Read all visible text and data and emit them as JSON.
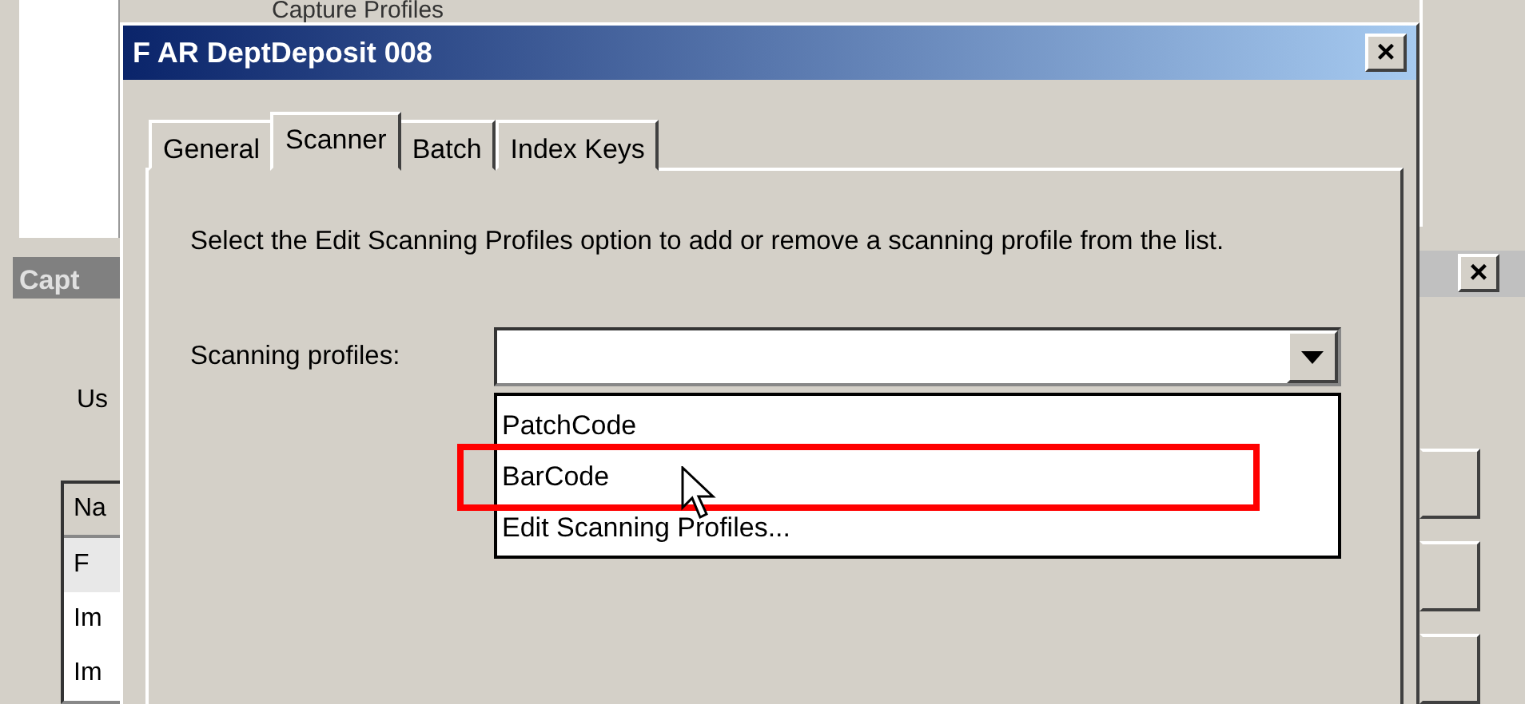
{
  "background_window": {
    "title": "Capture Profiles"
  },
  "capture_window": {
    "title": "Capt",
    "close": "×",
    "label": "Us",
    "list": {
      "header": "Na",
      "rows": [
        {
          "text": "F",
          "selected": true
        },
        {
          "text": "Im",
          "selected": false
        },
        {
          "text": "Im",
          "selected": false
        }
      ]
    }
  },
  "dialog": {
    "title": "F AR DeptDeposit 008",
    "close": "×",
    "tabs": [
      {
        "label": "General",
        "selected": false
      },
      {
        "label": "Scanner",
        "selected": true
      },
      {
        "label": "Batch",
        "selected": false
      },
      {
        "label": "Index Keys",
        "selected": false
      }
    ],
    "instruction": "Select the Edit Scanning Profiles option to add or remove a scanning profile from the list.",
    "field_label": "Scanning profiles:",
    "dropdown": {
      "expanded": true,
      "options": [
        {
          "label": "PatchCode",
          "annotated": false
        },
        {
          "label": "BarCode",
          "annotated": true
        },
        {
          "label": "Edit Scanning Profiles...",
          "annotated": false
        }
      ]
    }
  }
}
